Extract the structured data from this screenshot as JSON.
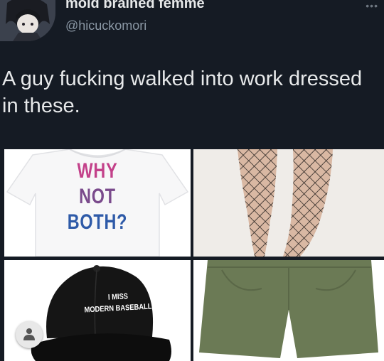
{
  "tweet": {
    "display_name": "moid brained femme",
    "handle": "@hicuckomori",
    "more_icon": "•••",
    "text": "A guy fucking walked into work dressed in these."
  },
  "images": {
    "shirt": {
      "line1": "WHY",
      "line2": "NOT",
      "line3": "BOTH?"
    },
    "cap": {
      "line1": "I MISS",
      "line2": "MODERN BASEBALL"
    }
  },
  "colors": {
    "background": "#151b24",
    "shirt_why": "#c3418a",
    "shirt_not": "#7a4a8c",
    "shirt_both": "#2e5aa8",
    "shorts": "#6b7a55"
  }
}
